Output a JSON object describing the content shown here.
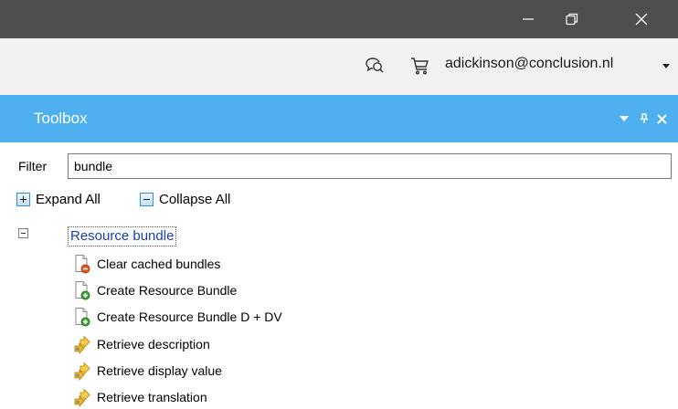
{
  "account": {
    "email": "adickinson@conclusion.nl"
  },
  "toolbox": {
    "title": "Toolbox",
    "filter_label": "Filter",
    "filter_value": "bundle",
    "expand_all": "Expand All",
    "collapse_all": "Collapse All",
    "group": {
      "label": "Resource bundle",
      "items": [
        {
          "label": "Clear cached bundles",
          "icon": "document-remove-icon"
        },
        {
          "label": "Create Resource Bundle",
          "icon": "document-add-icon"
        },
        {
          "label": "Create Resource Bundle D + DV",
          "icon": "document-add-icon"
        },
        {
          "label": "Retrieve description",
          "icon": "retrieve-arrow-icon"
        },
        {
          "label": "Retrieve display value",
          "icon": "retrieve-arrow-icon"
        },
        {
          "label": "Retrieve translation",
          "icon": "retrieve-arrow-icon"
        }
      ]
    }
  },
  "colors": {
    "titlebar": "#4e4e4e",
    "accountbar": "#f2f2f2",
    "toolbox_header": "#4fb0ef",
    "group_link": "#1a3fb5"
  }
}
